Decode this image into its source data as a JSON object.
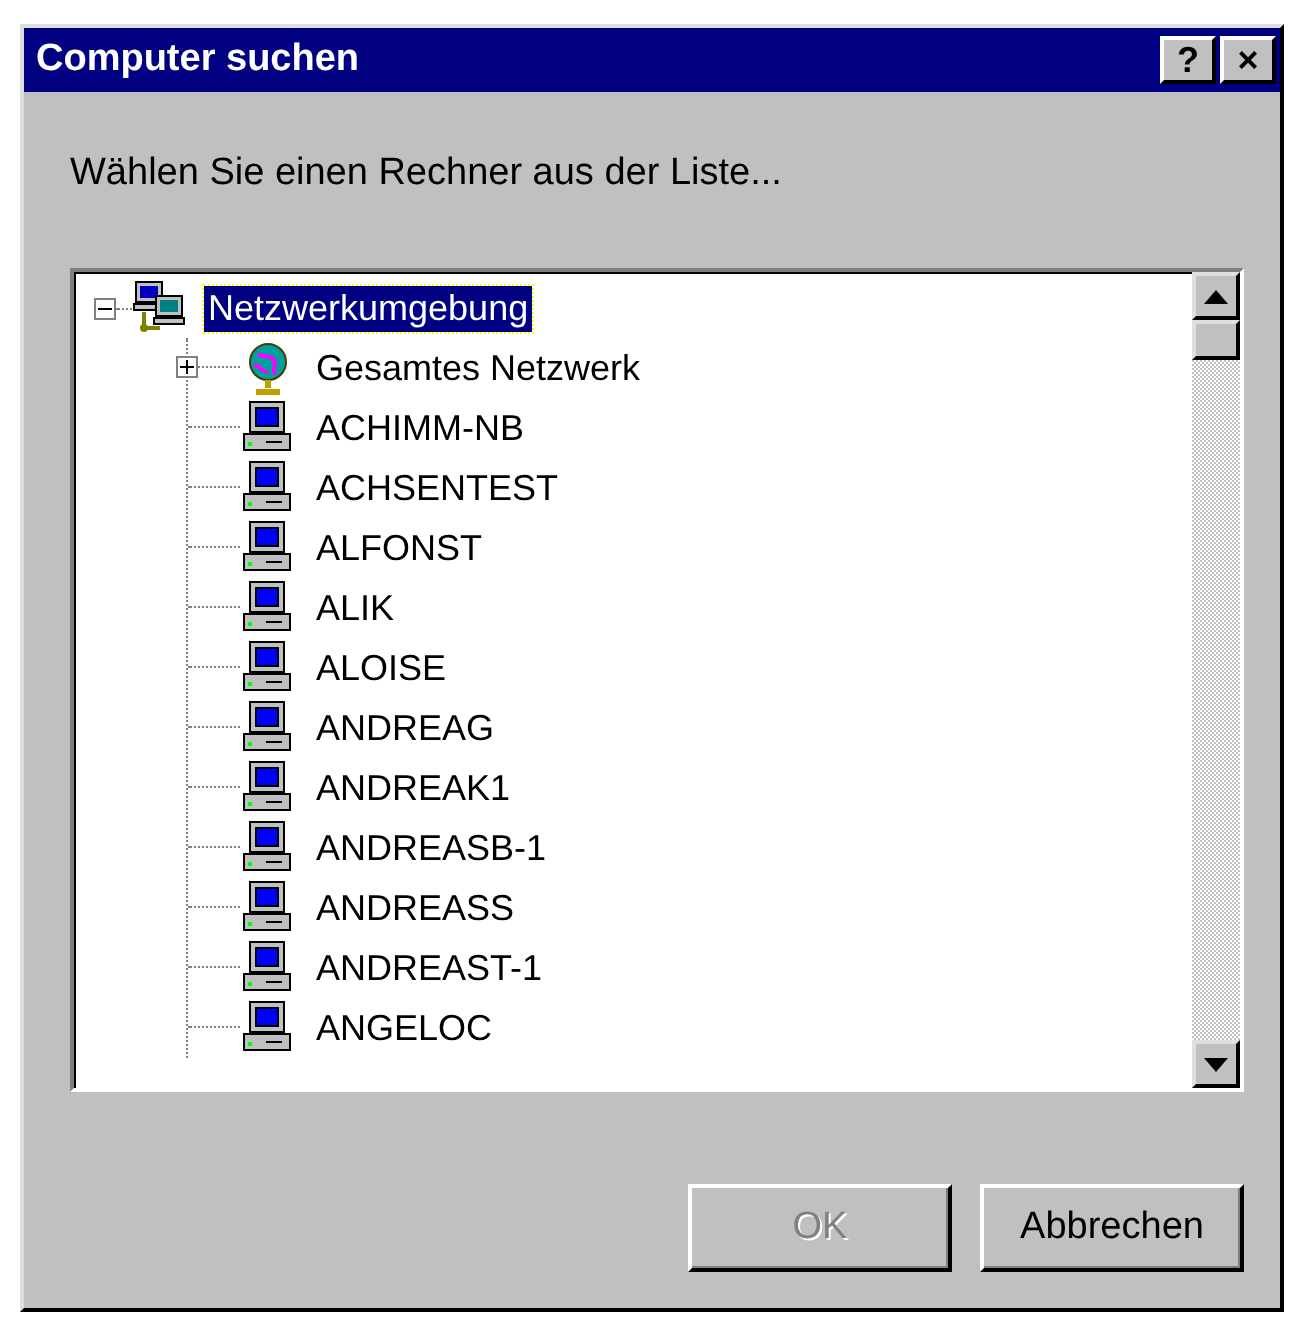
{
  "window": {
    "title": "Computer suchen",
    "title_buttons": [
      "?",
      "×"
    ]
  },
  "prompt": "Wählen Sie einen Rechner aus der Liste...",
  "tree": {
    "label": "Netzwerkumgebung",
    "kind": "network",
    "expanded": true,
    "selected": true,
    "children": [
      {
        "label": "Gesamtes Netzwerk",
        "kind": "globe",
        "expanded": false
      },
      {
        "label": "ACHIMM-NB",
        "kind": "computer"
      },
      {
        "label": "ACHSENTEST",
        "kind": "computer"
      },
      {
        "label": "ALFONST",
        "kind": "computer"
      },
      {
        "label": "ALIK",
        "kind": "computer"
      },
      {
        "label": "ALOISE",
        "kind": "computer"
      },
      {
        "label": "ANDREAG",
        "kind": "computer"
      },
      {
        "label": "ANDREAK1",
        "kind": "computer"
      },
      {
        "label": "ANDREASB-1",
        "kind": "computer"
      },
      {
        "label": "ANDREASS",
        "kind": "computer"
      },
      {
        "label": "ANDREAST-1",
        "kind": "computer"
      },
      {
        "label": "ANGELOC",
        "kind": "computer"
      }
    ]
  },
  "buttons": [
    {
      "label": "OK",
      "disabled": true
    },
    {
      "label": "Abbrechen",
      "disabled": false
    }
  ]
}
